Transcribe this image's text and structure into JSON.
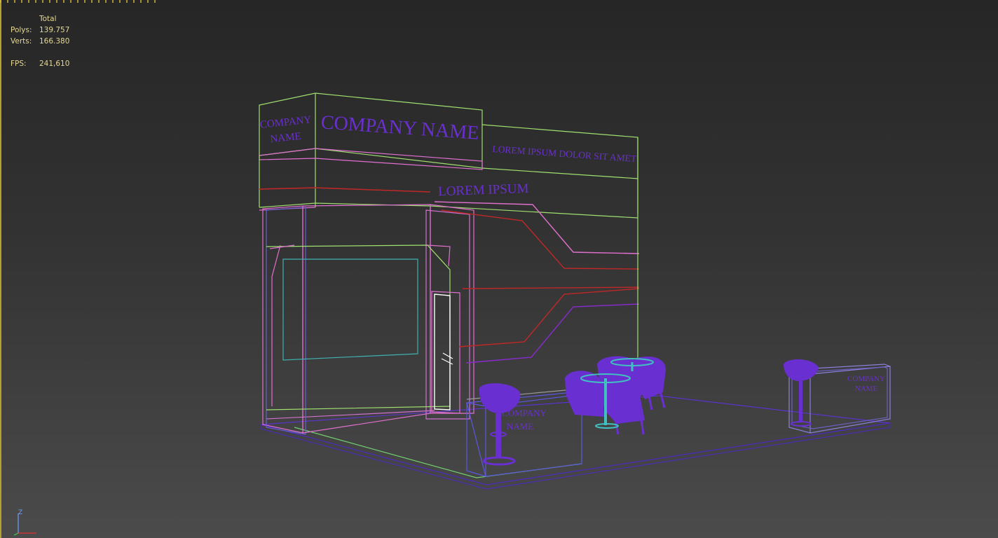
{
  "stats": {
    "header": "Total",
    "polys_label": "Polys:",
    "polys_value": "139.757",
    "verts_label": "Verts:",
    "verts_value": "166.380",
    "fps_label": "FPS:",
    "fps_value": "241,610"
  },
  "scene": {
    "header_left": [
      "COMPANY",
      "NAME"
    ],
    "header_main": "COMPANY NAME",
    "header_right": "LOREM IPSUM DOLOR SIT AMET",
    "wall_text": "LOREM IPSUM",
    "counter_front": [
      "COMPANY",
      "NAME"
    ],
    "counter_right": [
      "COMPANY",
      "NAME"
    ]
  },
  "gizmo": {
    "axis_z": "Z"
  },
  "colors": {
    "wire_green": "#9fe070",
    "wire_pink": "#e070d0",
    "wire_red": "#c02828",
    "wire_purple": "#6a2fd0",
    "wire_cyan": "#40c0c0",
    "wire_blue": "#4040c0",
    "stats_text": "#e4d896",
    "viewport_border": "#b8a030"
  }
}
